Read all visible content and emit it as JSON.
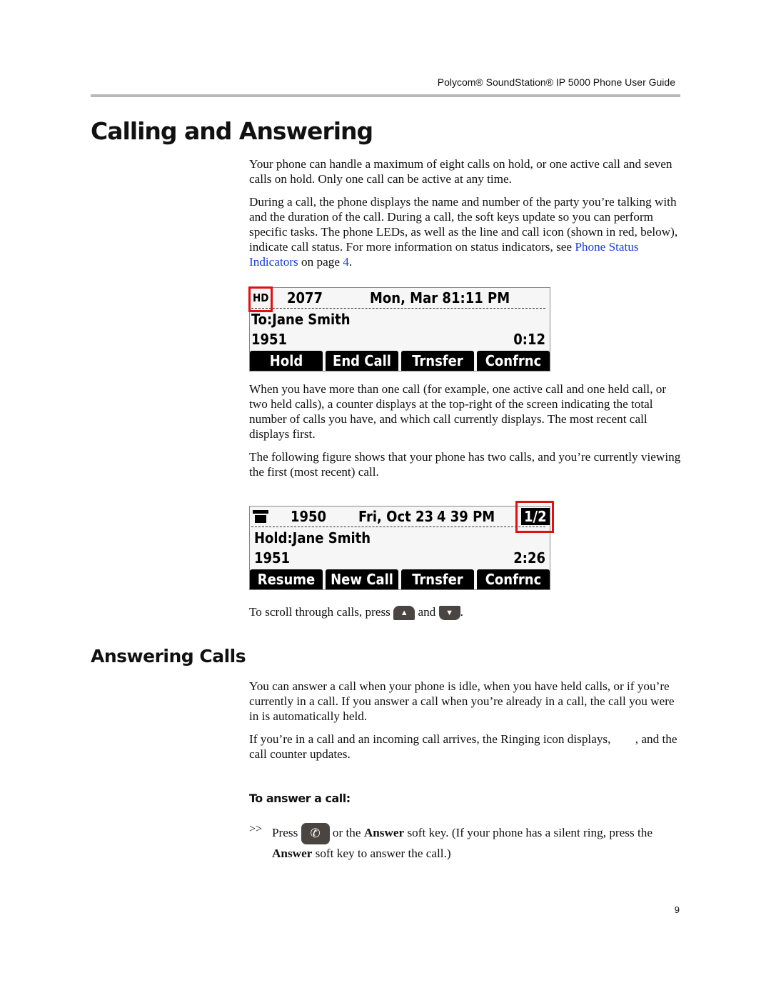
{
  "header": "Polycom® SoundStation® IP 5000 Phone User Guide",
  "title": "Calling and Answering",
  "intro": [
    "Your phone can handle a maximum of eight calls on hold, or one active call and seven calls on hold. Only one call can be active at any time.",
    "During a call, the phone displays the name and number of the party you’re talking with and the duration of the call. During a call, the soft keys update so you can perform specific tasks. The phone LEDs, as well as the line and call icon (shown in red, below), indicate call status. For more information on status indicators, see "
  ],
  "link_text": "Phone Status Indicators",
  "link_mid": " on page ",
  "link_page": "4",
  "screen1": {
    "icon": "HD",
    "ext": "2077",
    "date": "Mon, Mar 8",
    "time": "1:11 PM",
    "party": "To:Jane Smith",
    "number": "1951",
    "duration": "0:12",
    "keys": [
      "Hold",
      "End Call",
      "Trnsfer",
      "Confrnc"
    ]
  },
  "para3": "When you have more than one call (for example, one active call and one held call, or two held calls), a counter displays at the top-right of the screen indicating the total number of calls you have, and which call currently displays. The most recent call displays first.",
  "para4": "The following figure shows that your phone has two calls, and you’re currently viewing the first (most recent) call.",
  "screen2": {
    "ext": "1950",
    "date": "Fri, Oct 23",
    "time": "4 39 PM",
    "counter": "1/2",
    "party": "Hold:Jane Smith",
    "number": "1951",
    "duration": "2:26",
    "keys": [
      "Resume",
      "New Call",
      "Trnsfer",
      "Confrnc"
    ]
  },
  "scroll": {
    "pre": "To scroll through calls, press ",
    "and": " and ",
    "post": "."
  },
  "section2": "Answering Calls",
  "para5": "You can answer a call when your phone is idle, when you have held calls, or if you’re currently in a call. If you answer a call when you’re already in a call, the call you were in is automatically held.",
  "para6": "If you’re in a call and an incoming call arrives, the Ringing icon displays,        , and the call counter updates.",
  "procedure_title": "To answer a call:",
  "step": {
    "bullet": ">>",
    "press": "Press ",
    "mid": " or the ",
    "answer": "Answer",
    "rest": " soft key. (If your phone has a silent ring, press the ",
    "answer2": "Answer",
    "end": " soft key to answer the call.)"
  },
  "page_number": "9",
  "colors": {
    "link": "#1a3fd8",
    "highlight": "#e01010"
  }
}
